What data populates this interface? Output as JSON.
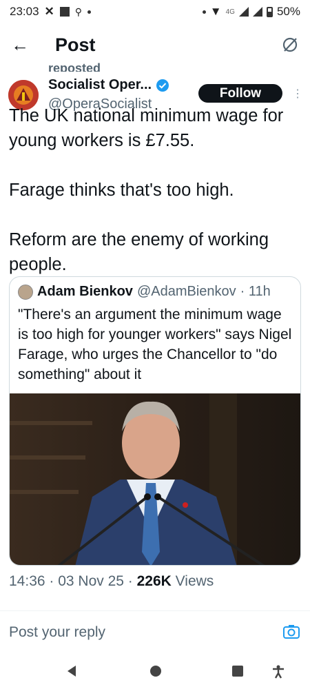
{
  "status_bar": {
    "time": "23:03",
    "network": "4G",
    "battery": "50%"
  },
  "header": {
    "title": "Post"
  },
  "repost_label": "reposted",
  "author": {
    "name": "Socialist Oper...",
    "handle": "@OperaSocialist",
    "follow_label": "Follow"
  },
  "tweet": {
    "paragraphs": [
      "The UK national minimum wage for young workers is £7.55.",
      "Farage thinks that's too high.",
      "Reform are the enemy of working people."
    ]
  },
  "quote": {
    "name": "Adam Bienkov",
    "handle": "@AdamBienkov",
    "time": "· 11h",
    "text": "\"There's an argument the minimum wage is too high for younger workers\" says Nigel Farage, who urges the Chancellor to \"do something\" about it"
  },
  "meta": {
    "time_date": "14:36 · 03 Nov 25 · ",
    "views_count": "226K",
    "views_label": "Views"
  },
  "reply": {
    "placeholder": "Post your reply"
  },
  "colors": {
    "accent": "#1d9bf0",
    "text": "#0f1419",
    "muted": "#536471"
  }
}
